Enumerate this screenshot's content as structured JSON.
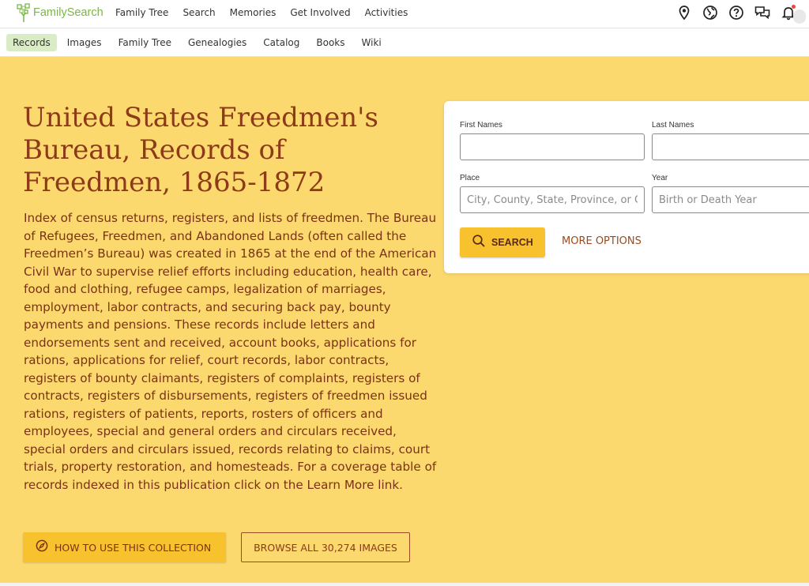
{
  "brand": {
    "name": "FamilySearch",
    "color": "#7ab648"
  },
  "main_nav": [
    "Family Tree",
    "Search",
    "Memories",
    "Get Involved",
    "Activities"
  ],
  "top_icons": [
    "map-pin-icon",
    "globe-icon",
    "help-icon",
    "chat-icon",
    "bell-icon"
  ],
  "subnav": {
    "items": [
      "Records",
      "Images",
      "Family Tree",
      "Genealogies",
      "Catalog",
      "Books",
      "Wiki"
    ],
    "active": "Records"
  },
  "collection": {
    "title": "United States Freedmen's Bureau, Records of Freedmen, 1865-1872",
    "description": "Index of census returns, registers, and lists of freedmen. The Bureau of Refugees, Freedmen, and Abandoned Lands (often called the Freedmen’s Bureau) was created in 1865 at the end of the American Civil War to supervise relief efforts including education, health care, food and clothing, refugee camps, legalization of marriages, employment, labor contracts, and securing back pay, bounty payments and pensions. These records include letters and endorsements sent and received, account books, applications for rations, applications for relief, court records, labor contracts, registers of bounty claimants, registers of complaints, registers of contracts, registers of disbursements, registers of freedmen issued rations, registers of patients, reports, rosters of officers and employees, special and general orders and circulars received, special orders and circulars issued, records relating to claims, court trials, property restoration, and homesteads. For a coverage table of records indexed in this publication click on the Learn More link.",
    "how_to_label": "HOW TO USE THIS COLLECTION",
    "browse_label": "BROWSE ALL 30,274 IMAGES"
  },
  "search_form": {
    "first_names_label": "First Names",
    "first_names_value": "",
    "last_names_label": "Last Names",
    "last_names_value": "",
    "place_label": "Place",
    "place_placeholder": "City, County, State, Province, or Country",
    "year_label": "Year",
    "year_placeholder": "Birth or Death Year",
    "search_label": "SEARCH",
    "more_options_label": "MORE OPTIONS"
  },
  "colors": {
    "hero_bg": "#fcd96f",
    "title_text": "#8c3a17",
    "button_yellow": "#f8c22f",
    "active_tab": "#d9ecc5"
  }
}
